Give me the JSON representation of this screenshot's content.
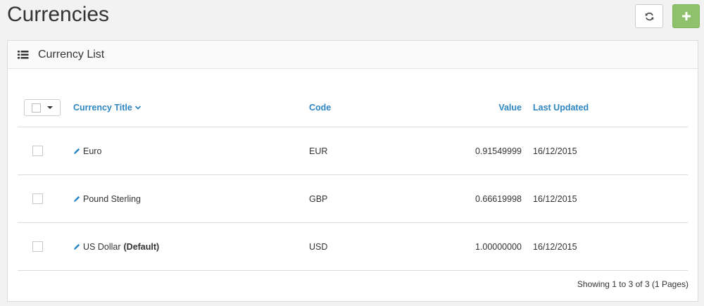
{
  "page": {
    "title": "Currencies"
  },
  "header_buttons": {
    "refresh_icon": "refresh-icon",
    "add_icon": "plus-icon"
  },
  "panel": {
    "title": "Currency List",
    "icon": "list-icon"
  },
  "columns": {
    "title": "Currency Title",
    "code": "Code",
    "value": "Value",
    "updated": "Last Updated"
  },
  "rows": [
    {
      "title": "Euro",
      "default_tag": "",
      "code": "EUR",
      "value": "0.91549999",
      "updated": "16/12/2015"
    },
    {
      "title": "Pound Sterling",
      "default_tag": "",
      "code": "GBP",
      "value": "0.66619998",
      "updated": "16/12/2015"
    },
    {
      "title": "US Dollar",
      "default_tag": "(Default)",
      "code": "USD",
      "value": "1.00000000",
      "updated": "16/12/2015"
    }
  ],
  "pager": {
    "info": "Showing 1 to 3 of 3 (1 Pages)"
  },
  "colors": {
    "link": "#2e86c1",
    "add_button": "#8fc06b"
  }
}
